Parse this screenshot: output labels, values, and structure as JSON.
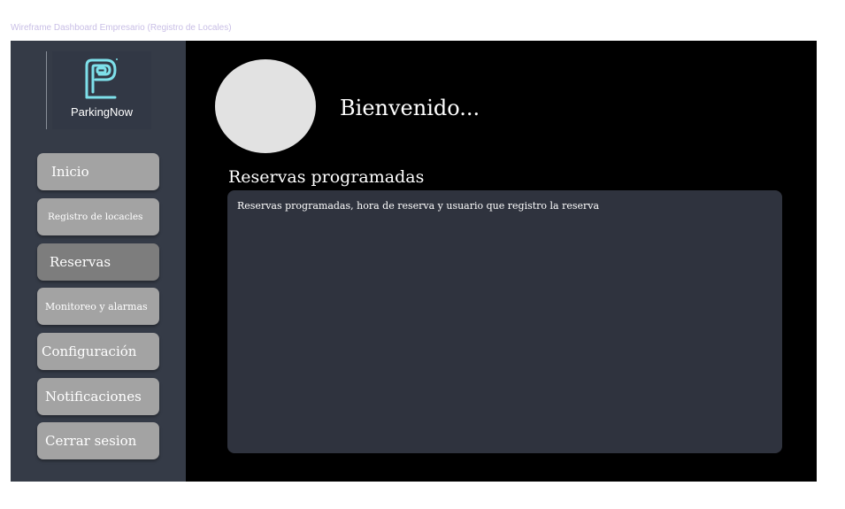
{
  "frame_label": "Wireframe Dashboard Empresario (Registro de Locales)",
  "logo": {
    "brand_text": "ParkingNow",
    "accent_color": "#7ee0ea"
  },
  "sidebar": {
    "items": [
      {
        "label": "Inicio"
      },
      {
        "label": "Registro de locacles"
      },
      {
        "label": "Reservas",
        "active": true
      },
      {
        "label": "Monitoreo y alarmas"
      },
      {
        "label": "Configuración"
      },
      {
        "label": "Notificaciones"
      },
      {
        "label": "Cerrar sesion"
      }
    ]
  },
  "header": {
    "welcome": "Bienvenido..."
  },
  "reservations": {
    "title": "Reservas programadas",
    "description": "Reservas programadas, hora de reserva y usuario que registro la reserva"
  },
  "colors": {
    "background": "#000000",
    "sidebar": "#353b47",
    "button": "#a3a3a3",
    "button_active": "#7d7d7d",
    "panel": "#2f333e"
  }
}
